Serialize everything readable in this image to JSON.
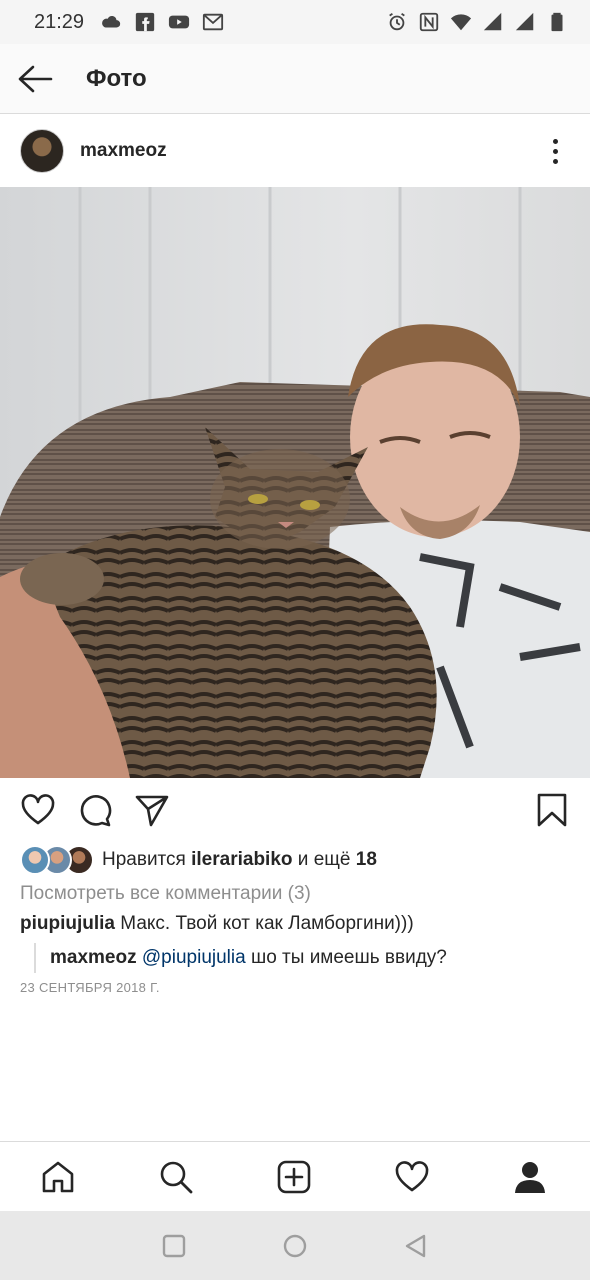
{
  "status_bar": {
    "time": "21:29",
    "left_icons": [
      "cloud-icon",
      "facebook-icon",
      "youtube-icon",
      "gmail-icon"
    ],
    "right_icons": [
      "alarm-icon",
      "nfc-icon",
      "wifi-icon",
      "signal-icon",
      "signal-icon",
      "battery-icon"
    ]
  },
  "header": {
    "title": "Фото",
    "back_icon": "arrow-left-icon"
  },
  "post": {
    "username": "maxmeoz",
    "more_icon": "more-vertical-icon",
    "photo_alt": "photo"
  },
  "actions": {
    "like_icon": "heart-icon",
    "comment_icon": "comment-icon",
    "share_icon": "send-icon",
    "save_icon": "bookmark-icon"
  },
  "likes": {
    "prefix": "Нравится",
    "user": "ilerariabiko",
    "middle": "и ещё",
    "count": "18"
  },
  "view_comments": "Посмотреть все комментарии (3)",
  "comment": {
    "user": "piupiujulia",
    "text": "Макс. Твой кот как Ламборгини)))"
  },
  "reply": {
    "user": "maxmeoz",
    "mention": "@piupiujulia",
    "text": "шо ты имеешь ввиду?"
  },
  "date": "23 СЕНТЯБРЯ 2018 Г.",
  "tabs": [
    "home-icon",
    "search-icon",
    "add-post-icon",
    "activity-heart-icon",
    "profile-icon"
  ],
  "colors": {
    "accent_mention": "#003569",
    "muted": "#8e8e8e",
    "text": "#262626"
  }
}
